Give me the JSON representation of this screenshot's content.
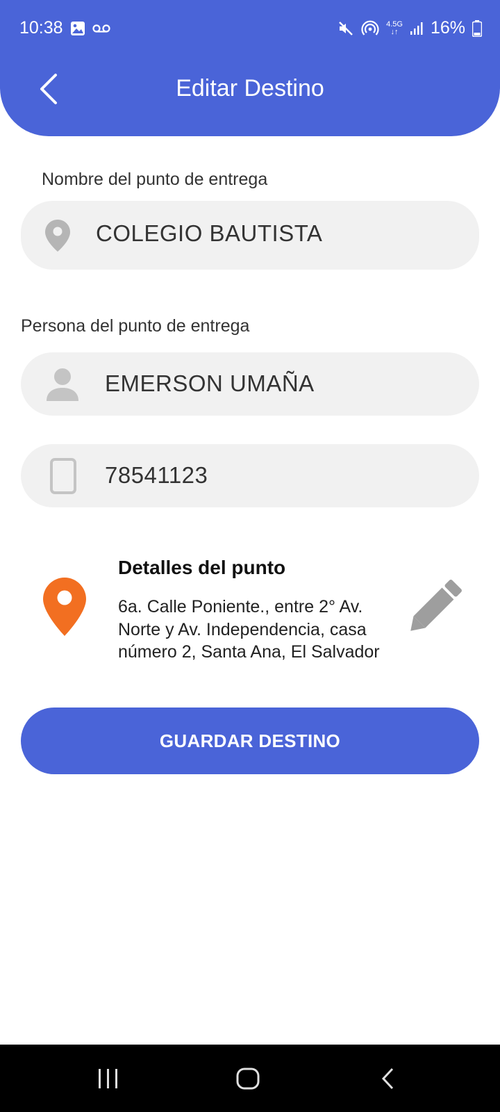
{
  "status_bar": {
    "time": "10:38",
    "icons_left": [
      "image-icon",
      "voicemail-icon"
    ],
    "icons_right": [
      "mute-icon",
      "hotspot-icon",
      "network-4g-icon",
      "signal-icon",
      "battery-icon"
    ],
    "network": "4.5G",
    "battery": "16%"
  },
  "header": {
    "title": "Editar Destino",
    "back_icon": "chevron-left-icon",
    "color": "#4a64d8"
  },
  "form": {
    "delivery_point_label": "Nombre del punto de entrega",
    "delivery_point_value": "COLEGIO BAUTISTA",
    "delivery_point_icon": "location-pin-icon",
    "person_label": "Persona del punto de entrega",
    "person_value": "EMERSON UMAÑA",
    "person_icon": "person-icon",
    "phone_value": "78541123",
    "phone_icon": "phone-icon"
  },
  "details": {
    "title": "Detalles del punto",
    "address": "6a. Calle Poniente., entre 2° Av. Norte y Av. Independencia, casa número 2, Santa Ana, El Salvador",
    "pin_icon": "map-marker-icon",
    "pin_color": "#f26f21",
    "edit_icon": "pencil-icon"
  },
  "actions": {
    "save_label": "GUARDAR DESTINO"
  },
  "nav": {
    "items": [
      "recents-icon",
      "home-icon",
      "back-icon"
    ]
  }
}
